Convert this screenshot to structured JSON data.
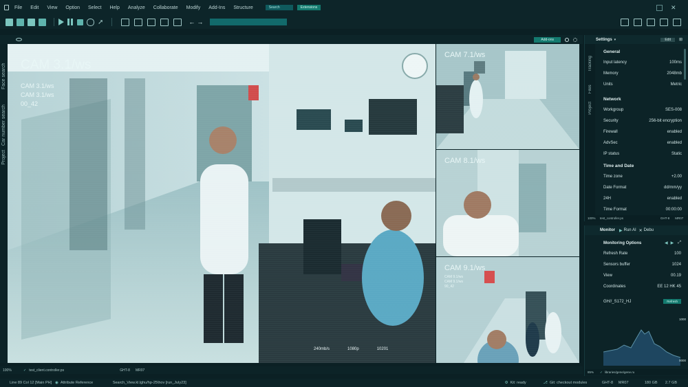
{
  "menu": {
    "items": [
      "File",
      "Edit",
      "View",
      "Option",
      "Select",
      "Help",
      "Analyze",
      "Collaborate",
      "Modify",
      "Add-Ins",
      "Structure"
    ],
    "search_label": "Search",
    "extensions_label": "Extensions"
  },
  "video_panel": {
    "addons_label": "Add-ons",
    "side_tabs": [
      "Face search",
      "Car number search",
      "Project"
    ],
    "main_cam": {
      "title": "CAM 3.1/ws",
      "line1": "CAM 3.1/ws",
      "line2": "CAM 3.1/ws",
      "line3": "00_42"
    },
    "cam7": {
      "title": "CAM 7.1/ws"
    },
    "cam8": {
      "title": "CAM 8.1/ws"
    },
    "cam9": {
      "title": "CAM 9.1/ws",
      "line1": "CAM 9.1/ws",
      "line2": "CAM 9.1/ws",
      "line3": "90_42"
    },
    "main_readouts": [
      "240mb/s",
      "1080p",
      "10201"
    ],
    "bottom": {
      "zoom": "100%",
      "file": "test_client.controller.ps",
      "tag1": "GHT-8",
      "tag2": "MR07"
    }
  },
  "settings": {
    "title": "Settings",
    "edit_label": "Edit",
    "side_tabs": [
      "Tracking",
      "Files",
      "Project"
    ],
    "general_title": "General",
    "general": [
      {
        "label": "Input latency",
        "value": "100ms"
      },
      {
        "label": "Memory",
        "value": "2048mb"
      },
      {
        "label": "Units",
        "value": "Metric"
      }
    ],
    "network_title": "Network",
    "network": [
      {
        "label": "Workgroup",
        "value": "SES-008"
      },
      {
        "label": "Security",
        "value": "256-bit encryption"
      },
      {
        "label": "Firewall",
        "value": "enabled"
      },
      {
        "label": "AdvSec",
        "value": "enabled"
      },
      {
        "label": "IP status",
        "value": "Static"
      }
    ],
    "time_title": "Time and Date",
    "time": [
      {
        "label": "Time zone",
        "value": "+2.00"
      },
      {
        "label": "Date Format",
        "value": "dd/mm/yy"
      },
      {
        "label": "24H",
        "value": "enabled"
      },
      {
        "label": "Time Format",
        "value": "00:00:00"
      }
    ],
    "bottom": {
      "zoom": "100%",
      "file": "test_controller.ps",
      "tag1": "GHT-8",
      "tag2": "MR07"
    }
  },
  "monitor": {
    "tabs": [
      "Monitor",
      "Run AI",
      "Debu"
    ],
    "options_title": "Monitoring Options",
    "rows": [
      {
        "label": "Refresh Rate",
        "value": "100"
      },
      {
        "label": "Sensors buffer",
        "value": "1024"
      },
      {
        "label": "View",
        "value": "00.19"
      },
      {
        "label": "Coordinates",
        "value": "EE 12 HK 45"
      }
    ],
    "code": "GH//_S172_HJ",
    "refresh_label": "Refresh",
    "graph_top": "1000",
    "graph_bottom": "0000",
    "bottom": {
      "zoom": "85%",
      "file": "libraries/gene/gene.ru"
    }
  },
  "status": {
    "left": "Line 89 Col 12 [Main PH]",
    "ref": "Attribute Reference",
    "path": "Search_View.kl.lghu/hp-25\\hov [run_July23]",
    "kit": "Kit: ready",
    "git": "Git: checkout modules",
    "tag1": "GHT-8",
    "tag2": "MR07",
    "disk1": "180 GB",
    "disk2": "2.7 GB"
  }
}
